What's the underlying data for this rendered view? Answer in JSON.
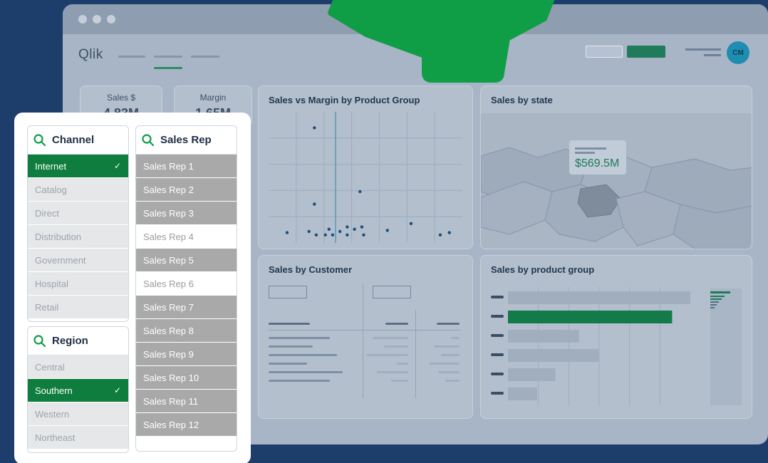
{
  "app": {
    "brand": "Qlik",
    "avatar_initials": "CM",
    "brand_color": "#0f9d46",
    "selected_color": "#0f7d3d"
  },
  "kpis": [
    {
      "label": "Sales $",
      "value": "4.83M"
    },
    {
      "label": "Margin",
      "value": "1.65M"
    }
  ],
  "charts": {
    "scatter_title": "Sales vs Margin by Product Group",
    "map_title": "Sales by state",
    "map_value": "$569.5M",
    "customer_title": "Sales by Customer",
    "product_title": "Sales by product group"
  },
  "chart_data": [
    {
      "type": "scatter",
      "title": "Sales vs Margin by Product Group",
      "points": [
        [
          0.22,
          0.96
        ],
        [
          0.22,
          0.29
        ],
        [
          0.47,
          0.4
        ],
        [
          0.07,
          0.04
        ],
        [
          0.19,
          0.05
        ],
        [
          0.23,
          0.02
        ],
        [
          0.28,
          0.02
        ],
        [
          0.3,
          0.07
        ],
        [
          0.32,
          0.02
        ],
        [
          0.36,
          0.05
        ],
        [
          0.4,
          0.09
        ],
        [
          0.4,
          0.02
        ],
        [
          0.44,
          0.07
        ],
        [
          0.48,
          0.09
        ],
        [
          0.49,
          0.02
        ],
        [
          0.62,
          0.06
        ],
        [
          0.75,
          0.12
        ],
        [
          0.91,
          0.02
        ],
        [
          0.96,
          0.04
        ]
      ]
    },
    {
      "type": "bar",
      "title": "Sales by product group",
      "orientation": "horizontal",
      "values": [
        100,
        90,
        39,
        50,
        26,
        16
      ],
      "highlighted_index": 1
    }
  ],
  "filters": {
    "channel": {
      "title": "Channel",
      "items": [
        {
          "label": "Internet",
          "state": "sel"
        },
        {
          "label": "Catalog",
          "state": "alt"
        },
        {
          "label": "Direct",
          "state": "alt"
        },
        {
          "label": "Distribution",
          "state": "alt"
        },
        {
          "label": "Government",
          "state": "alt"
        },
        {
          "label": "Hospital",
          "state": "alt"
        },
        {
          "label": "Retail",
          "state": "alt"
        }
      ]
    },
    "region": {
      "title": "Region",
      "items": [
        {
          "label": "Central",
          "state": "alt"
        },
        {
          "label": "Southern",
          "state": "sel"
        },
        {
          "label": "Western",
          "state": "alt"
        },
        {
          "label": "Northeast",
          "state": "alt"
        }
      ]
    },
    "salesrep": {
      "title": "Sales Rep",
      "items": [
        {
          "label": "Sales Rep 1",
          "state": "poss"
        },
        {
          "label": "Sales Rep 2",
          "state": "poss"
        },
        {
          "label": "Sales Rep 3",
          "state": "poss"
        },
        {
          "label": "Sales Rep 4",
          "state": "white"
        },
        {
          "label": "Sales Rep 5",
          "state": "poss"
        },
        {
          "label": "Sales Rep 6",
          "state": "white"
        },
        {
          "label": "Sales Rep 7",
          "state": "poss"
        },
        {
          "label": "Sales Rep 8",
          "state": "poss"
        },
        {
          "label": "Sales Rep 9",
          "state": "poss"
        },
        {
          "label": "Sales Rep 10",
          "state": "poss"
        },
        {
          "label": "Sales Rep 11",
          "state": "poss"
        },
        {
          "label": "Sales Rep 12",
          "state": "poss"
        }
      ]
    }
  }
}
